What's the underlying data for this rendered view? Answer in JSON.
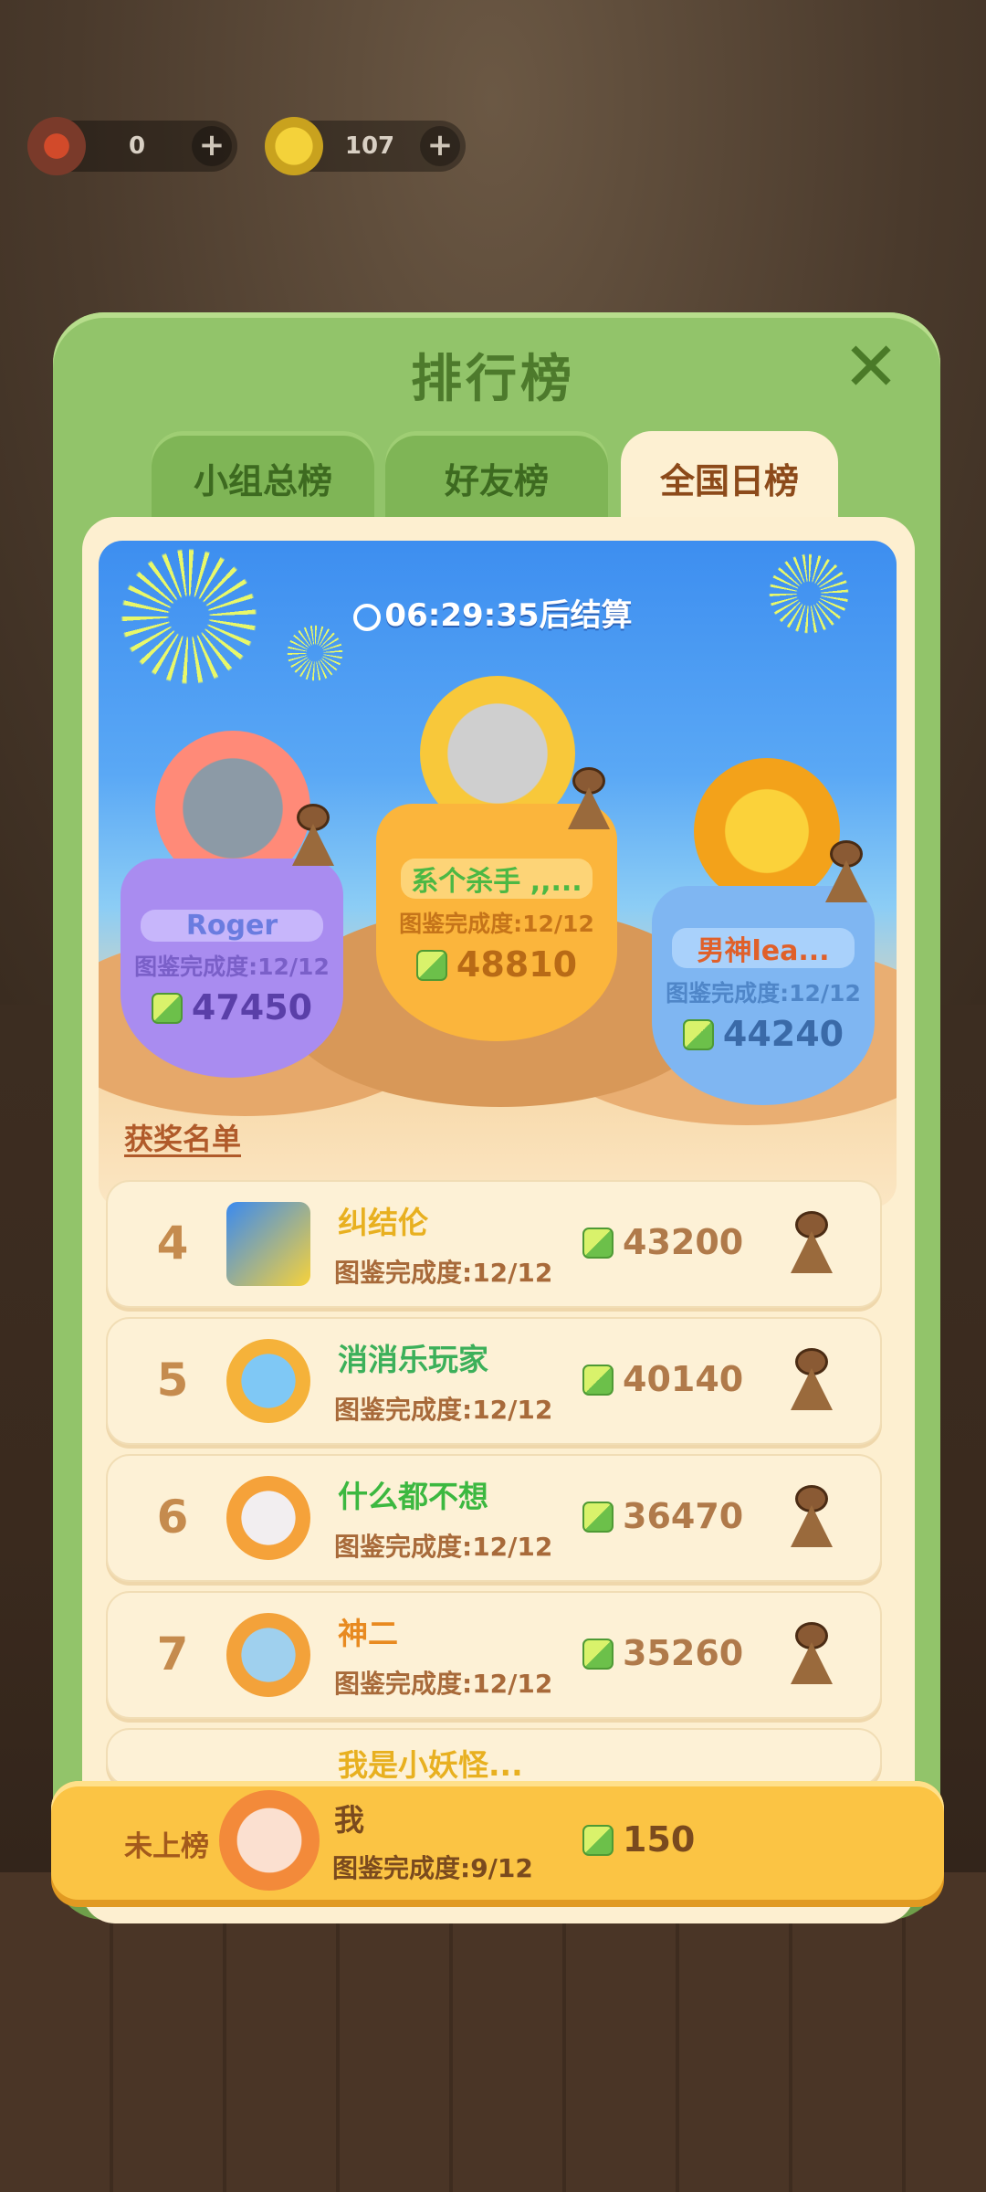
{
  "resources": {
    "rocket_count": "0",
    "coin_count": "107",
    "plus": "+"
  },
  "panel": {
    "title": "排行榜",
    "close": "✕",
    "tabs": [
      "小组总榜",
      "好友榜",
      "全国日榜"
    ],
    "active_tab": "全国日榜"
  },
  "timer": {
    "time": "06:29:35",
    "suffix": "后结算"
  },
  "podium": [
    {
      "rank": 2,
      "name": "Roger",
      "completion": "图鉴完成度:12/12",
      "score": "47450",
      "color": "#a98cf0"
    },
    {
      "rank": 1,
      "name": "系个杀手 ,,...",
      "completion": "图鉴完成度:12/12",
      "score": "48810",
      "color": "#fbb53c"
    },
    {
      "rank": 3,
      "name": "男神lea...",
      "completion": "图鉴完成度:12/12",
      "score": "44240",
      "color": "#7fb6f2"
    }
  ],
  "section_title": "获奖名单",
  "list": [
    {
      "rank": "4",
      "name": "纠结伦",
      "completion": "图鉴完成度:12/12",
      "score": "43200"
    },
    {
      "rank": "5",
      "name": "消消乐玩家",
      "completion": "图鉴完成度:12/12",
      "score": "40140"
    },
    {
      "rank": "6",
      "name": "什么都不想",
      "completion": "图鉴完成度:12/12",
      "score": "36470"
    },
    {
      "rank": "7",
      "name": "神二",
      "completion": "图鉴完成度:12/12",
      "score": "35260"
    },
    {
      "rank": "",
      "name": "我是小妖怪...",
      "completion": "",
      "score": ""
    }
  ],
  "me": {
    "label": "未上榜",
    "name": "我",
    "completion": "图鉴完成度:9/12",
    "score": "150"
  },
  "colors": {
    "panel_green": "#92c46a",
    "title_green": "#4d7a2c",
    "cream": "#fdefd0",
    "my_bar": "#fbc444"
  }
}
